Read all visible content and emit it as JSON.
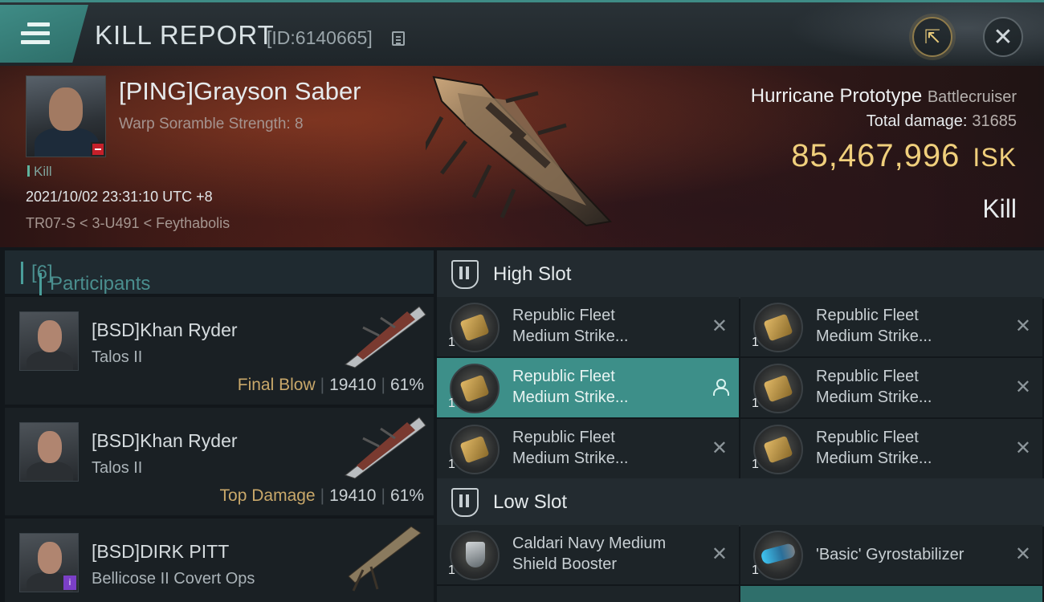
{
  "header": {
    "title": "KILL REPORT",
    "id_label": "[ID:6140665]"
  },
  "victim": {
    "name": "[PING]Grayson Saber",
    "warp_info": "Warp Soramble Strength: 8",
    "type_tag": "Kill",
    "datetime": "2021/10/02 23:31:10 UTC +8",
    "location": "TR07-S < 3-U491 < Feythabolis",
    "ship_name": "Hurricane Prototype",
    "ship_class": "Battlecruiser",
    "total_damage_label": "Total damage:",
    "total_damage": "31685",
    "isk_value": "85,467,996",
    "isk_unit": "ISK",
    "result": "Kill"
  },
  "participants": {
    "title": "Participants",
    "count": "[6]",
    "rows": [
      {
        "name": "[BSD]Khan Ryder",
        "ship": "Talos II",
        "label": "Final Blow",
        "damage": "19410",
        "percent": "61%"
      },
      {
        "name": "[BSD]Khan Ryder",
        "ship": "Talos II",
        "label": "Top Damage",
        "damage": "19410",
        "percent": "61%"
      },
      {
        "name": "[BSD]DIRK PITT",
        "ship": "Bellicose II Covert Ops"
      }
    ]
  },
  "slots": {
    "high": {
      "title": "High Slot",
      "modules": [
        {
          "line1": "Republic Fleet",
          "line2": "Medium Strike...",
          "qty": "1"
        },
        {
          "line1": "Republic Fleet",
          "line2": "Medium Strike...",
          "qty": "1"
        },
        {
          "line1": "Republic Fleet",
          "line2": "Medium Strike...",
          "qty": "1"
        },
        {
          "line1": "Republic Fleet",
          "line2": "Medium Strike...",
          "qty": "1"
        },
        {
          "line1": "Republic Fleet",
          "line2": "Medium Strike...",
          "qty": "1"
        },
        {
          "line1": "Republic Fleet",
          "line2": "Medium Strike...",
          "qty": "1"
        }
      ]
    },
    "low": {
      "title": "Low Slot",
      "modules": [
        {
          "line1": "Caldari Navy Medium",
          "line2": "Shield Booster",
          "qty": "1"
        },
        {
          "line1": "'Basic' Gyrostabilizer",
          "qty": "1"
        }
      ]
    }
  },
  "icons": {
    "menu": "menu-icon",
    "copy": "copy-icon",
    "share": "share-icon",
    "close": "close-icon",
    "remove": "close-x-icon",
    "user": "user-icon",
    "slot": "slot-icon"
  },
  "colors": {
    "accent": "#3f8c86",
    "isk": "#f0cf7c",
    "highlight_label": "#c9a86a"
  }
}
